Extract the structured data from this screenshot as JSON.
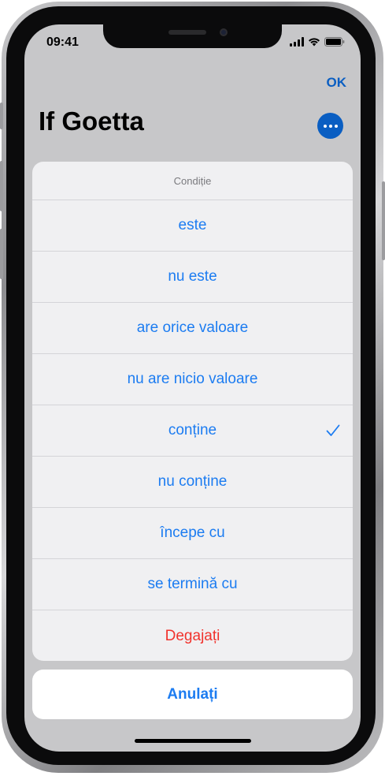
{
  "status_bar": {
    "time": "09:41",
    "icons": [
      "signal-icon",
      "wifi-icon",
      "battery-icon"
    ]
  },
  "header": {
    "done_label": "OK",
    "title": "If Goetta",
    "more_icon": "ellipsis-icon"
  },
  "sheet": {
    "title": "Condiție",
    "options": [
      {
        "label": "este",
        "selected": false
      },
      {
        "label": "nu este",
        "selected": false
      },
      {
        "label": "are orice valoare",
        "selected": false
      },
      {
        "label": "nu are nicio valoare",
        "selected": false
      },
      {
        "label": "conține",
        "selected": true
      },
      {
        "label": "nu conține",
        "selected": false
      },
      {
        "label": "începe cu",
        "selected": false
      },
      {
        "label": "se termină cu",
        "selected": false
      }
    ],
    "destructive_label": "Degajați",
    "cancel_label": "Anulați"
  },
  "colors": {
    "accent": "#1c7cf1",
    "destructive": "#f1322c",
    "dimmed_accent": "#0a5ec2"
  }
}
